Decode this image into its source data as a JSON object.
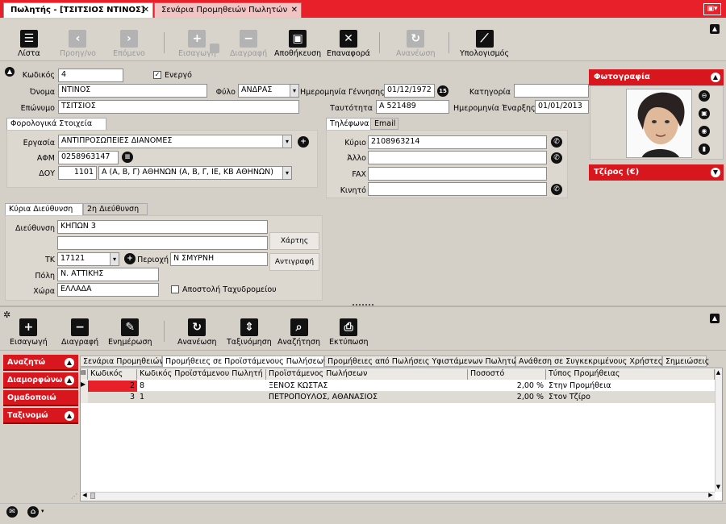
{
  "tabs": [
    {
      "label": "Πωλητής - [ΤΣΙΤΣΙΟΣ ΝΤΙΝΟΣ]"
    },
    {
      "label": "Σενάρια Προμηθειών Πωλητών"
    }
  ],
  "toolbar": {
    "list": "Λίστα",
    "prev": "Προηγ/νο",
    "next": "Επόμενο",
    "insert": "Εισαγωγή",
    "delete": "Διαγραφή",
    "save": "Αποθήκευση",
    "restore": "Επαναφορά",
    "refresh": "Ανανέωση",
    "calc": "Υπολογισμός"
  },
  "form": {
    "code_label": "Κωδικός",
    "code": "4",
    "active_label": "Ενεργό",
    "name_label": "Όνομα",
    "name": "ΝΤΙΝΟΣ",
    "gender_label": "Φύλο",
    "gender": "ΑΝΔΡΑΣ",
    "dob_label": "Ημερομηνία Γέννησης",
    "dob": "01/12/1972",
    "category_label": "Κατηγορία",
    "category": "",
    "surname_label": "Επώνυμο",
    "surname": "ΤΣΙΤΣΙΟΣ",
    "id_label": "Ταυτότητα",
    "id": "Α 521489",
    "start_label": "Ημερομηνία Έναρξης",
    "start": "01/01/2013"
  },
  "tax": {
    "tab": "Φορολογικά Στοιχεία",
    "job_label": "Εργασία",
    "job": "ΑΝΤΙΠΡΟΣΩΠΕΙΕΣ ΔΙΑΝΟΜΕΣ",
    "afm_label": "ΑΦΜ",
    "afm": "0258963147",
    "doy_label": "ΔΟΥ",
    "doy_code": "1101",
    "doy": "Α (Α, Β, Γ) ΑΘΗΝΩΝ (Α, Β, Γ, ΙΕ, ΚΒ ΑΘΗΝΩΝ)"
  },
  "phones": {
    "tab1": "Τηλέφωνα",
    "tab2": "Email",
    "main_label": "Κύριο",
    "main": "2108963214",
    "other_label": "Άλλο",
    "other": "",
    "fax_label": "FAX",
    "fax": "",
    "mobile_label": "Κινητό",
    "mobile": ""
  },
  "address": {
    "tab1": "Κύρια Διεύθυνση",
    "tab2": "2η Διεύθυνση",
    "addr_label": "Διεύθυνση",
    "addr1": "ΚΗΠΩΝ 3",
    "addr2": "",
    "map_btn": "Χάρτης",
    "tk_label": "ΤΚ",
    "tk": "17121",
    "area_label": "Περιοχή",
    "area": "Ν ΣΜΥΡΝΗ",
    "copy_btn": "Αντιγραφή",
    "city_label": "Πόλη",
    "city": "Ν. ΑΤΤΙΚΗΣ",
    "country_label": "Χώρα",
    "country": "ΕΛΛΑΔΑ",
    "mail_label": "Αποστολή Ταχυδρομείου"
  },
  "photo": {
    "title": "Φωτογραφία"
  },
  "turnover": {
    "title": "Τζίρος (€)"
  },
  "toolbar2": {
    "insert": "Εισαγωγή",
    "delete": "Διαγραφή",
    "update": "Ενημέρωση",
    "refresh": "Ανανέωση",
    "sort": "Ταξινόμηση",
    "search": "Αναζήτηση",
    "print": "Εκτύπωση"
  },
  "side": {
    "search": "Αναζητώ",
    "format": "Διαμορφώνω",
    "group": "Ομαδοποιώ",
    "sort": "Ταξινομώ"
  },
  "grid_tabs": [
    "Σενάρια Προμηθειών",
    "Προμήθειες σε Προϊστάμενους Πωλήσεων",
    "Προμήθειες από Πωλήσεις Υφιστάμενων Πωλητών",
    "Ανάθεση σε Συγκεκριμένους Χρήστες",
    "Σημειώσεις"
  ],
  "grid": {
    "headers": [
      "Κωδικός",
      "Κωδικός Προϊστάμενου Πωλητή",
      "Προϊστάμενος Πωλήσεων",
      "Ποσοστό",
      "Τύπος Προμήθειας"
    ],
    "rows": [
      [
        "2",
        "8",
        "ΞΕΝΟΣ ΚΩΣΤΑΣ",
        "2,00 %",
        "Στην Προμήθεια"
      ],
      [
        "3",
        "1",
        "ΠΕΤΡΟΠΟΥΛΟΣ, ΑΘΑΝΑΣΙΟΣ",
        "2,00 %",
        "Στον Τζίρο"
      ]
    ]
  },
  "colors": {
    "accent": "#d8161e",
    "toolbar": "#d8d4cc"
  }
}
